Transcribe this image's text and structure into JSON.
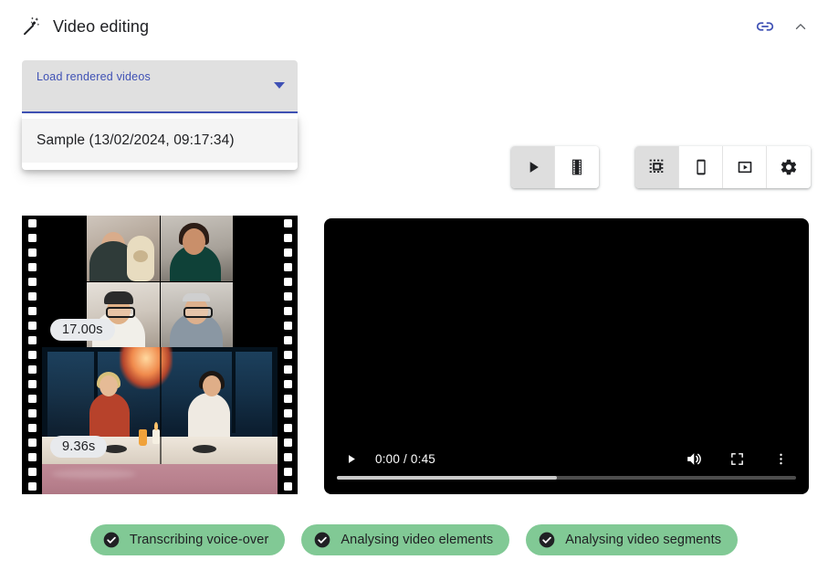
{
  "header": {
    "title": "Video editing",
    "wand_icon": "magic-wand-icon",
    "link_icon": "link-icon",
    "collapse_icon": "chevron-up-icon"
  },
  "select": {
    "label": "Load rendered videos",
    "arrow_icon": "dropdown-arrow-icon",
    "options": [
      {
        "label": "Sample (13/02/2024, 09:17:34)"
      }
    ]
  },
  "toolbar": {
    "group_playback": [
      {
        "name": "play-button",
        "icon": "play-icon",
        "selected": true
      },
      {
        "name": "filmstrip-button",
        "icon": "film-strip-icon",
        "selected": false
      }
    ],
    "group_format": [
      {
        "name": "square-format-button",
        "icon": "dotted-square-icon",
        "selected": true
      },
      {
        "name": "portrait-format-button",
        "icon": "smartphone-icon",
        "selected": false
      },
      {
        "name": "landscape-format-button",
        "icon": "smart-display-icon",
        "selected": false
      },
      {
        "name": "settings-button",
        "icon": "gear-icon",
        "selected": false
      }
    ]
  },
  "filmstrip": {
    "clips": [
      {
        "duration": "17.00s",
        "selected": true
      },
      {
        "duration": "9.36s",
        "selected": false
      },
      {
        "duration": "",
        "selected": false
      }
    ]
  },
  "player": {
    "play_icon": "play-icon",
    "time": "0:00 / 0:45",
    "volume_icon": "volume-up-icon",
    "fullscreen_icon": "fullscreen-icon",
    "more_icon": "more-vertical-icon",
    "buffered_percent": 48
  },
  "status_chips": [
    {
      "label": "Transcribing voice-over",
      "icon": "check-circle-icon"
    },
    {
      "label": "Analysing video elements",
      "icon": "check-circle-icon"
    },
    {
      "label": "Analysing video segments",
      "icon": "check-circle-icon"
    }
  ],
  "colors": {
    "accent": "#3f51b5",
    "chip_green": "#81c995",
    "selection_green": "#8bd5a0",
    "select_field_bg": "#e0e0e0"
  }
}
